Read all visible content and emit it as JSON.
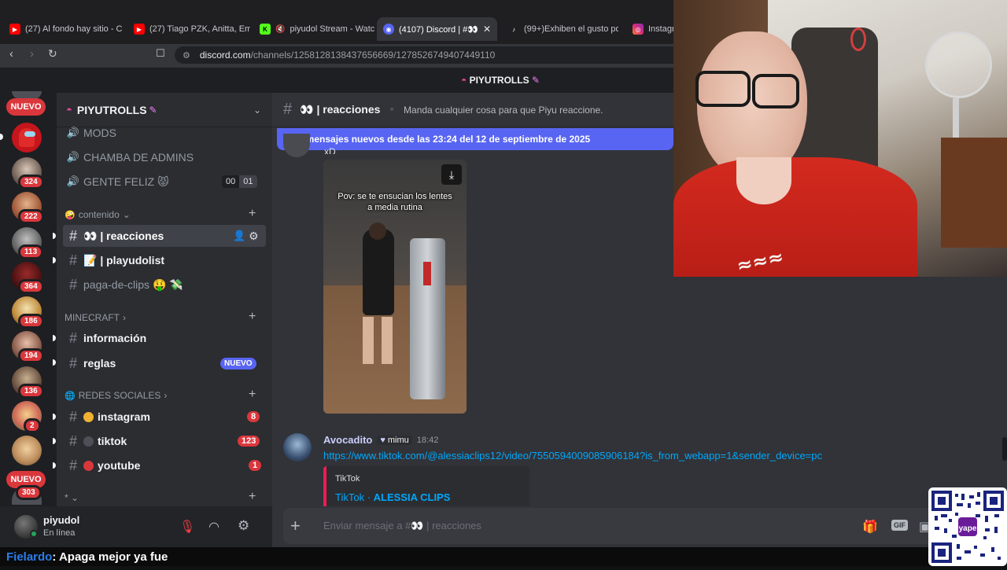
{
  "browser": {
    "tabs": [
      {
        "label": "(27) Al fondo hay sitio - C",
        "icon": "youtube-icon",
        "color": "#ff0000"
      },
      {
        "label": "(27) Tiago PZK, Anitta, Em",
        "icon": "youtube-icon",
        "color": "#ff0000"
      },
      {
        "label": "piyudol Stream - Watc",
        "icon": "kick-icon",
        "color": "#53fc18"
      },
      {
        "label": "(4107) Discord | #👀",
        "icon": "discord-icon",
        "color": "#5865f2"
      },
      {
        "label": "(99+)Exhiben el gusto por",
        "icon": "tiktok-icon",
        "color": "#ffffff"
      },
      {
        "label": "Instagra",
        "icon": "instagram-icon",
        "color": "#e1306c"
      }
    ],
    "url_domain": "discord.com",
    "url_path": "/channels/1258128138437656669/1278526749407449110"
  },
  "discord": {
    "top_title": "PIYUTROLLS",
    "rail": {
      "top_badge": "NUEVO",
      "bottom_badge": "NUEVO",
      "servers": [
        {
          "badge": ""
        },
        {
          "badge": "324"
        },
        {
          "badge": "222"
        },
        {
          "badge": "113"
        },
        {
          "badge": "364"
        },
        {
          "badge": "186"
        },
        {
          "badge": "194"
        },
        {
          "badge": "136"
        },
        {
          "badge": "2"
        },
        {
          "badge": ""
        },
        {
          "badge": "303"
        }
      ]
    },
    "guild_name": "PIYUTROLLS",
    "channels_top": [
      {
        "name": "MODS"
      },
      {
        "name": "CHAMBA DE ADMINS"
      },
      {
        "name": "GENTE FELIZ 😾",
        "voice_a": "00",
        "voice_b": "01"
      }
    ],
    "category_contenido": "contenido",
    "contenido_channels": [
      {
        "name": "👀 | reacciones"
      },
      {
        "name": "📝 | playudolist"
      },
      {
        "name": "paga-de-clips 🤑 💸"
      }
    ],
    "category_minecraft": "MINECRAFT",
    "minecraft_channels": [
      {
        "name": "información"
      },
      {
        "name": "reglas",
        "badge": "NUEVO"
      }
    ],
    "category_redes": "REDES SOCIALES",
    "redes_channels": [
      {
        "name": "instagram",
        "count": "8"
      },
      {
        "name": "tiktok",
        "count": "123"
      },
      {
        "name": "youtube",
        "count": "1"
      }
    ],
    "category_extra": "* ⌄",
    "user": {
      "name": "piyudol",
      "status": "En línea"
    },
    "channel_header": {
      "name": "👀 | reacciones",
      "topic": "Manda cualquier cosa para que Piyu reaccione."
    },
    "new_messages_bar": "18 mensajes nuevos desde las 23:24 del 12 de septiembre de 2025",
    "video_caption": "Pov: se te ensucian los lentes a media rutina",
    "prev_fragment": "xD",
    "message": {
      "author": "Avocadito",
      "role_tag": "mimu",
      "time": "18:42",
      "link": "https://www.tiktok.com/@alessiaclips12/video/7550594009085906184?is_from_webapp=1&sender_device=pc",
      "embed_provider": "TikTok",
      "embed_title_prefix": "TikTok · ",
      "embed_title": "ALESSIA CLIPS"
    },
    "input_placeholder": "Enviar mensaje a #👀 | reacciones"
  },
  "overlay": {
    "chat_user": "Fielardo",
    "chat_text": " : Apaga mejor ya fue"
  }
}
